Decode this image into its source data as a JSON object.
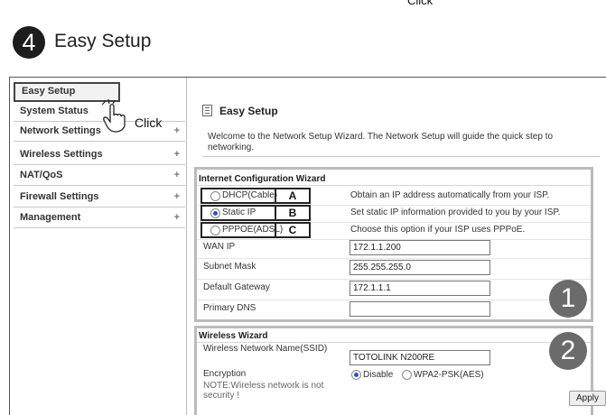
{
  "annotations": {
    "top_click": "Click",
    "hand_click": "Click",
    "step_number": "4",
    "step_title": "Easy Setup"
  },
  "sidebar": {
    "items": [
      {
        "label": "Easy Setup",
        "expand": ""
      },
      {
        "label": "System Status",
        "expand": ""
      },
      {
        "label": "Network Settings",
        "expand": "+"
      },
      {
        "label": "Wireless Settings",
        "expand": "+"
      },
      {
        "label": "NAT/QoS",
        "expand": "+"
      },
      {
        "label": "Firewall Settings",
        "expand": "+"
      },
      {
        "label": "Management",
        "expand": "+"
      }
    ]
  },
  "main": {
    "title": "Easy Setup",
    "welcome": "Welcome to the Network Setup Wizard. The Network Setup will guide the quick step to networking."
  },
  "internet_wizard": {
    "title": "Internet Configuration Wizard",
    "options": [
      {
        "label": "DHCP(Cable)",
        "letter": "A",
        "selected": false,
        "description": "Obtain an IP address automatically from your ISP."
      },
      {
        "label": "Static IP",
        "letter": "B",
        "selected": true,
        "description": "Set static IP information provided to you by your ISP."
      },
      {
        "label": "PPPOE(ADSL)",
        "letter": "C",
        "selected": false,
        "description": "Choose this option if your ISP uses PPPoE."
      }
    ],
    "fields": [
      {
        "label": "WAN IP",
        "value": "172.1.1.200"
      },
      {
        "label": "Subnet Mask",
        "value": "255.255.255.0"
      },
      {
        "label": "Default Gateway",
        "value": "172.1.1.1"
      },
      {
        "label": "Primary DNS",
        "value": ""
      }
    ],
    "marker": "1"
  },
  "wireless_wizard": {
    "title": "Wireless Wizard",
    "ssid_label": "Wireless Network Name(SSID)",
    "ssid_value": "TOTOLINK N200RE",
    "encryption_label": "Encryption",
    "encryption_options": [
      {
        "label": "Disable",
        "selected": true
      },
      {
        "label": "WPA2-PSK(AES)",
        "selected": false
      }
    ],
    "note": "NOTE:Wireless network is not security !",
    "apply_label": "Apply",
    "marker": "2"
  },
  "colors": {
    "accent_radio": "#2a4fd8",
    "marker_gray": "#6b6b6b",
    "border_gray": "#bbbbbb"
  }
}
